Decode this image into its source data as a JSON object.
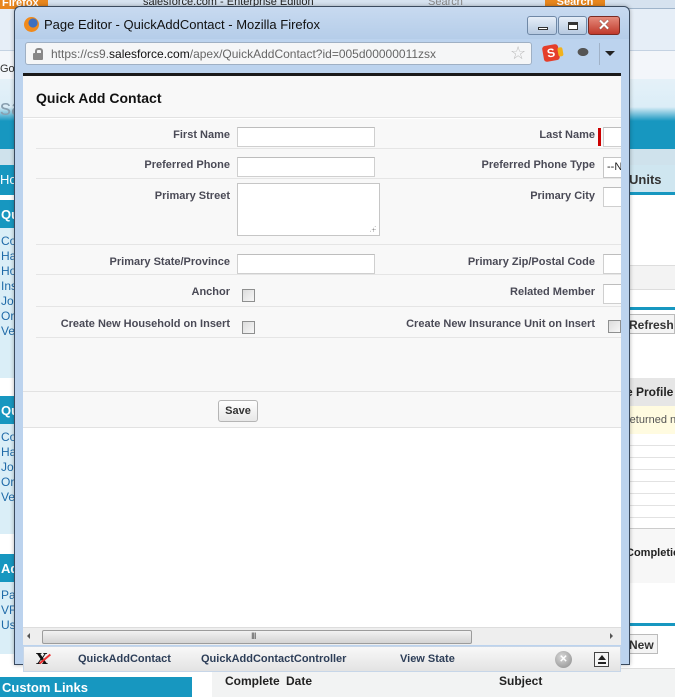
{
  "background": {
    "firefox_menu": "Firefox",
    "tab_title": "salesforce.com - Enterprise Edition",
    "search_placeholder": "Search",
    "search_button": "Search",
    "bookmark_fragment": "Goo",
    "logo_fragment": "sa",
    "nav_tab_fragment": "Ho",
    "units_tab_fragment": "Units",
    "sidebar_sections": [
      {
        "title": "Qu",
        "items": [
          "Co",
          "Ha",
          "Ho",
          "Ins",
          "Jo",
          "Or",
          "Ve"
        ]
      },
      {
        "title": "Qu",
        "items": [
          "Co",
          "Ha",
          "Jo",
          "Or",
          "Ve"
        ]
      },
      {
        "title": "Ad",
        "items": [
          "Pa",
          "VF",
          "Us"
        ]
      }
    ],
    "custom_links": "Custom Links",
    "refresh_button": "Refresh",
    "profile_header": "e Profile",
    "returned_text": "returned n",
    "completion_text": "-\nCompletion",
    "new_button": "New",
    "bottom_table_headers": [
      "Complete",
      "Date",
      "Subject"
    ]
  },
  "window": {
    "title": "Page Editor - QuickAddContact - Mozilla Firefox",
    "url_prefix": "https://cs9.",
    "url_domain": "salesforce.com",
    "url_path": "/apex/QuickAddContact?id=005d00000011zsx",
    "icons": [
      "firefox-icon",
      "lock-icon",
      "star-icon",
      "salesforce-extension-icon",
      "firebug-icon",
      "menu-arrow-icon"
    ]
  },
  "page": {
    "title": "Quick Add Contact",
    "fields": {
      "first_name": {
        "label": "First Name",
        "value": ""
      },
      "last_name": {
        "label": "Last Name",
        "value": "",
        "required": true
      },
      "preferred_phone": {
        "label": "Preferred Phone",
        "value": ""
      },
      "preferred_phone_type": {
        "label": "Preferred Phone Type",
        "value": "--None--"
      },
      "primary_street": {
        "label": "Primary Street",
        "value": ""
      },
      "primary_city": {
        "label": "Primary City",
        "value": ""
      },
      "primary_state": {
        "label": "Primary State/Province",
        "value": ""
      },
      "primary_zip": {
        "label": "Primary Zip/Postal Code",
        "value": ""
      },
      "anchor": {
        "label": "Anchor",
        "checked": false
      },
      "related_member": {
        "label": "Related Member",
        "value": ""
      },
      "create_household": {
        "label": "Create New Household on Insert",
        "checked": false
      },
      "create_insurance_unit": {
        "label": "Create New Insurance Unit on Insert",
        "checked": false
      }
    },
    "save_button": "Save"
  },
  "devbar": {
    "tabs": [
      "QuickAddContact",
      "QuickAddContactController",
      "View State"
    ]
  },
  "colors": {
    "salesforce_blue": "#1797c0",
    "required_red": "#cc0000",
    "label_text": "#4a4a56"
  }
}
